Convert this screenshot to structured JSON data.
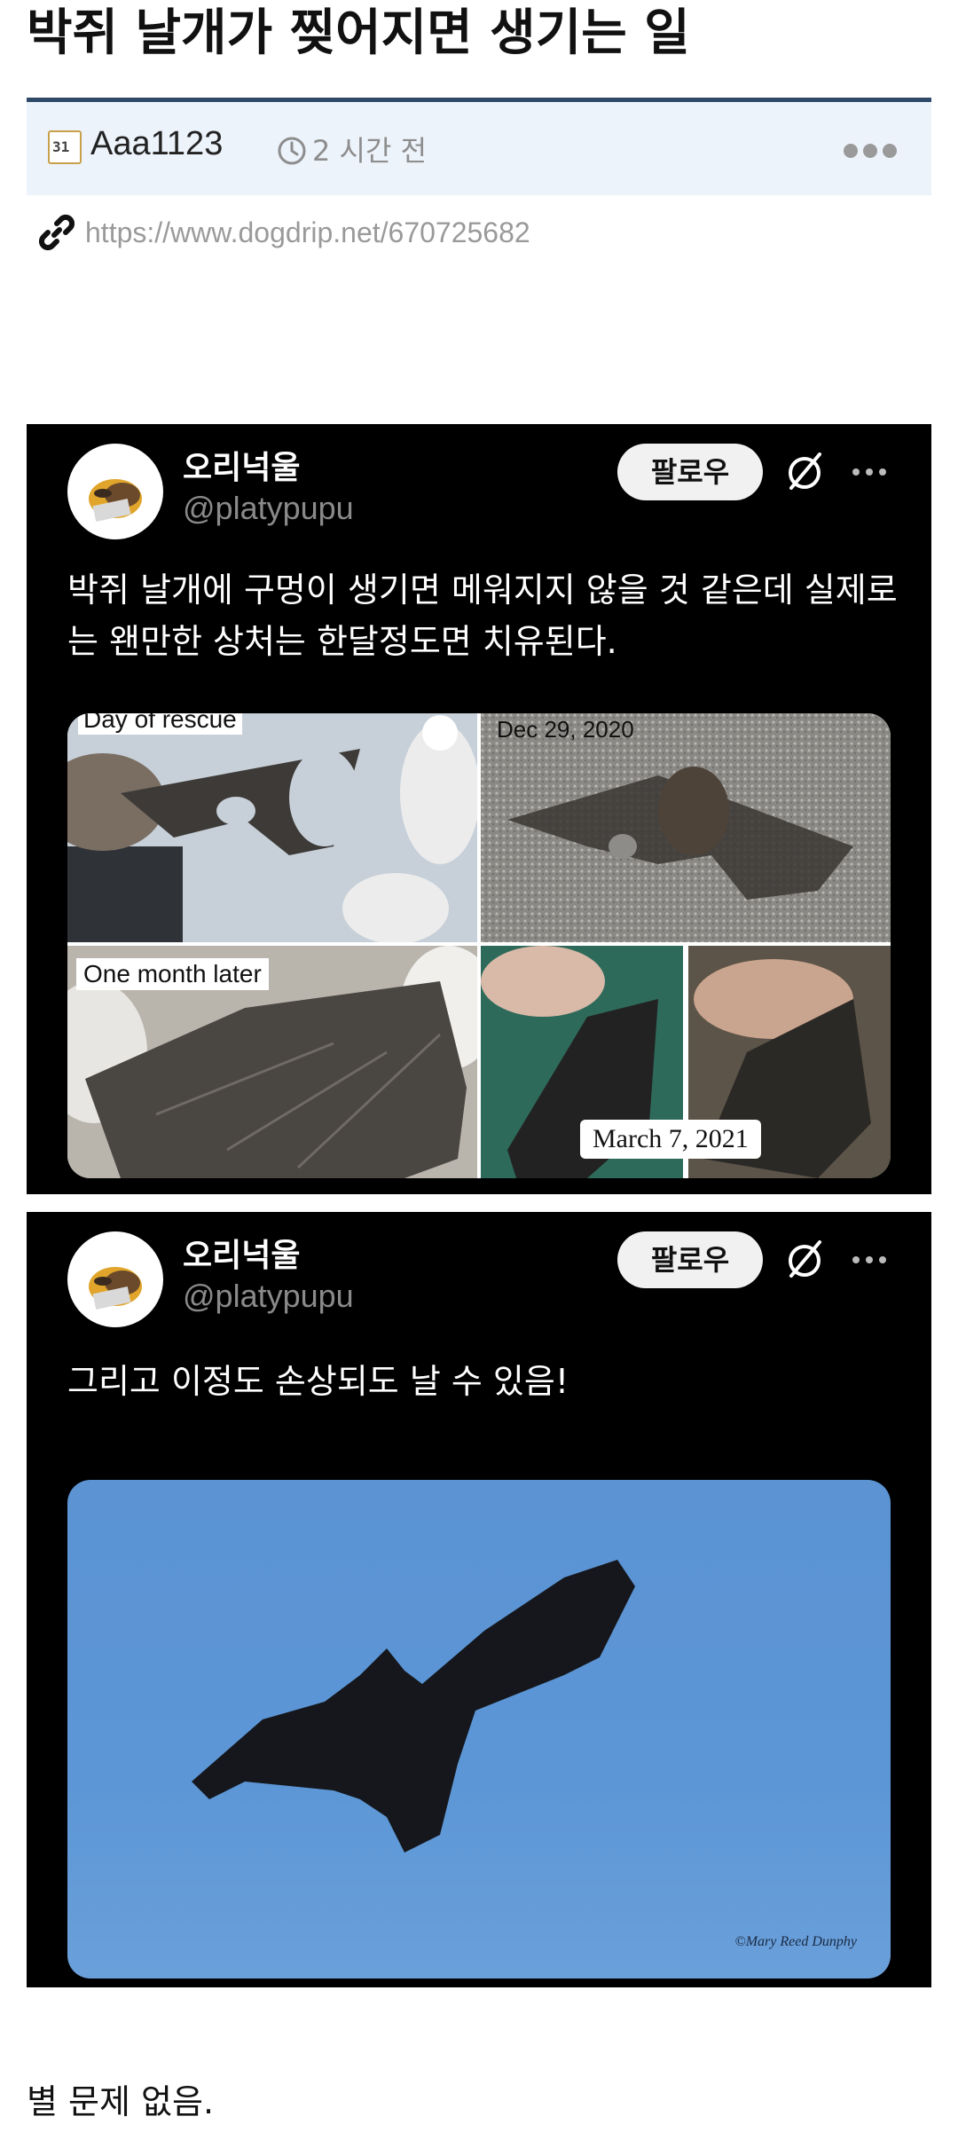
{
  "post": {
    "title": "박쥐 날개가 찢어지면 생기는 일",
    "author_icon_text": "31",
    "author": "Aaa1123",
    "time": "2 시간 전",
    "link": "https://www.dogdrip.net/670725682",
    "body": "별 문제 없음."
  },
  "tweets": [
    {
      "display_name": "오리넉울",
      "handle": "@platypupu",
      "follow_label": "팔로우",
      "text": "박쥐 날개에 구멍이 생기면 메워지지 않을 것 같은데 실제로는 왠만한 상처는 한달정도면 치유된다.",
      "photos": [
        {
          "caption": "Day of rescue"
        },
        {
          "caption": "Dec 29, 2020"
        },
        {
          "caption": "One month later"
        },
        {
          "caption": "March 7, 2021"
        }
      ]
    },
    {
      "display_name": "오리넉울",
      "handle": "@platypupu",
      "follow_label": "팔로우",
      "text": "그리고 이정도 손상되도 날 수 있음!",
      "photo_watermark": "©Mary Reed Dunphy"
    }
  ],
  "icons": {
    "author": "calendar-icon",
    "time": "clock-icon",
    "more": "ellipsis-icon",
    "link": "link-icon",
    "grok": "slash-circle-icon"
  },
  "colors": {
    "title_border": "#2f4a68",
    "meta_bg": "#edf3fb",
    "tweet_bg": "#000000",
    "sky": "#5c96d6"
  }
}
